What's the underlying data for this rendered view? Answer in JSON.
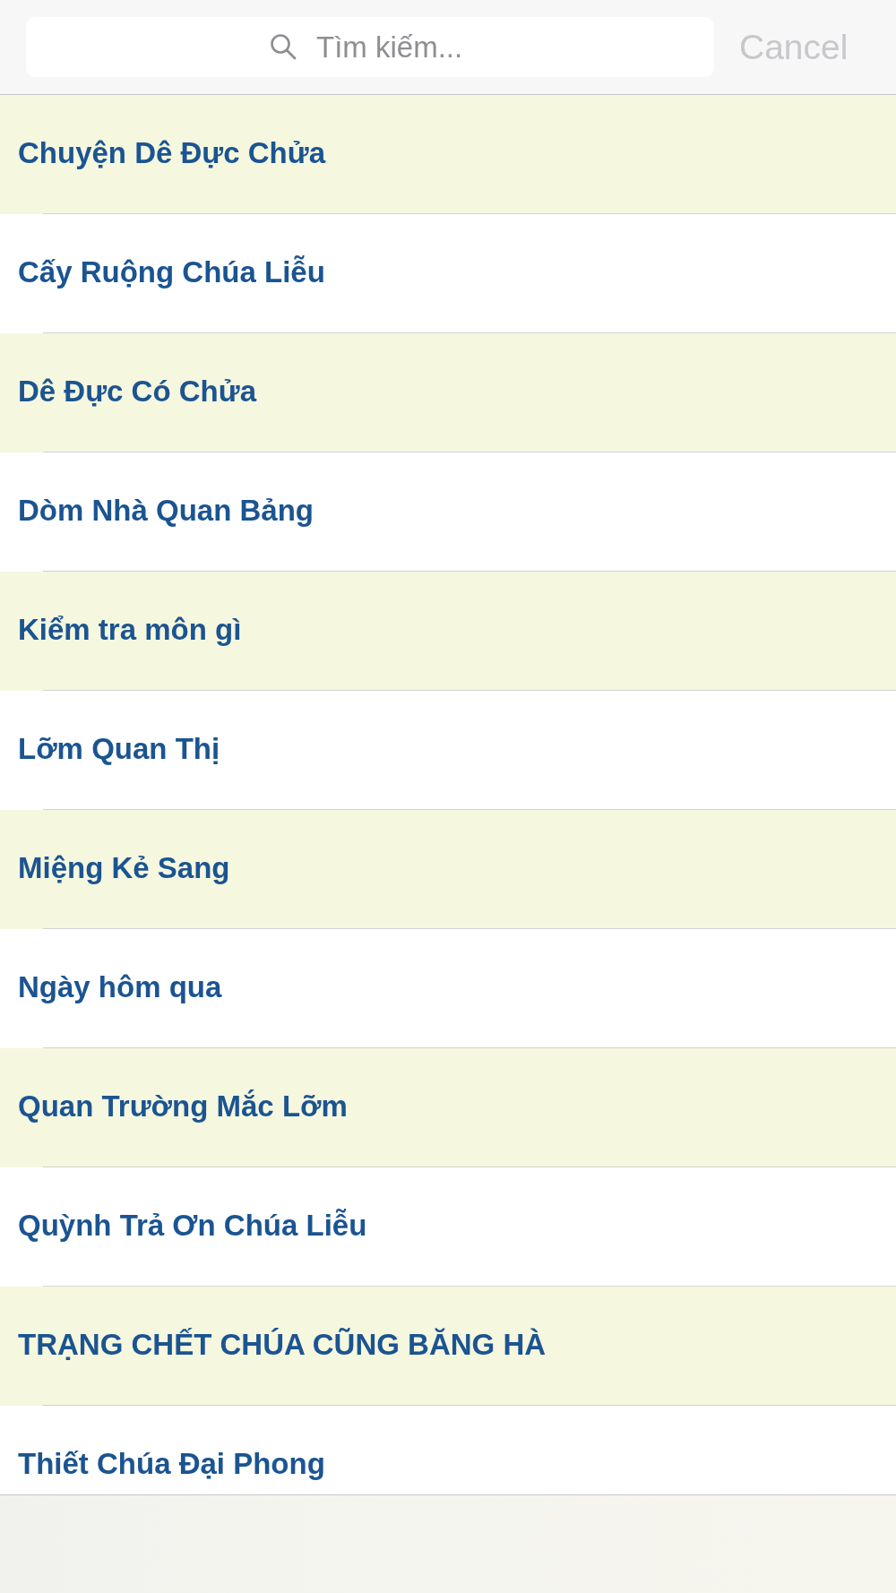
{
  "search": {
    "placeholder": "Tìm kiếm...",
    "cancel": "Cancel"
  },
  "items": [
    "Chuyện Dê Đực Chửa",
    "Cấy Ruộng Chúa Liễu",
    "Dê Đực Có Chửa",
    "Dòm Nhà Quan Bảng",
    "Kiểm tra môn gì",
    "Lỡm Quan Thị",
    "Miệng Kẻ Sang",
    "Ngày hôm qua",
    "Quan Trường Mắc Lỡm",
    "Quỳnh Trả Ơn Chúa Liễu",
    "TRẠNG CHẾT CHÚA CŨNG BĂNG HÀ",
    "Thiết Chúa Đại Phong"
  ]
}
